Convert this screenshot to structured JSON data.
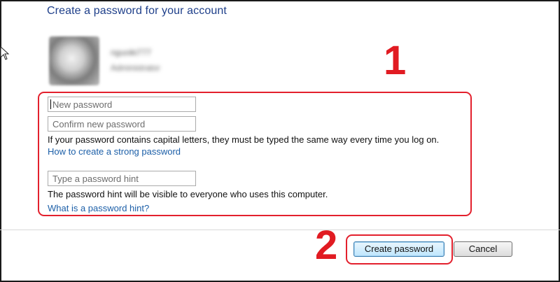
{
  "header": {
    "title": "Create a password for your account"
  },
  "account": {
    "name": "nguoiki777",
    "role": "Administrator"
  },
  "form": {
    "new_password": {
      "value": "",
      "placeholder": "New password"
    },
    "confirm_password": {
      "value": "",
      "placeholder": "Confirm new password"
    },
    "caps_info": "If your password contains capital letters, they must be typed the same way every time you log on.",
    "strong_password_link": "How to create a strong password",
    "hint": {
      "value": "",
      "placeholder": "Type a password hint"
    },
    "hint_info": "The password hint will be visible to everyone who uses this computer.",
    "hint_link": "What is a password hint?"
  },
  "buttons": {
    "create_label": "Create password",
    "cancel_label": "Cancel"
  },
  "annotations": {
    "marker_1": "1",
    "marker_2": "2"
  },
  "colors": {
    "annotation": "#e3202d",
    "title": "#1e3f8a",
    "link": "#1c5fa8"
  },
  "icons": {
    "cursor": "mouse-pointer-icon"
  }
}
